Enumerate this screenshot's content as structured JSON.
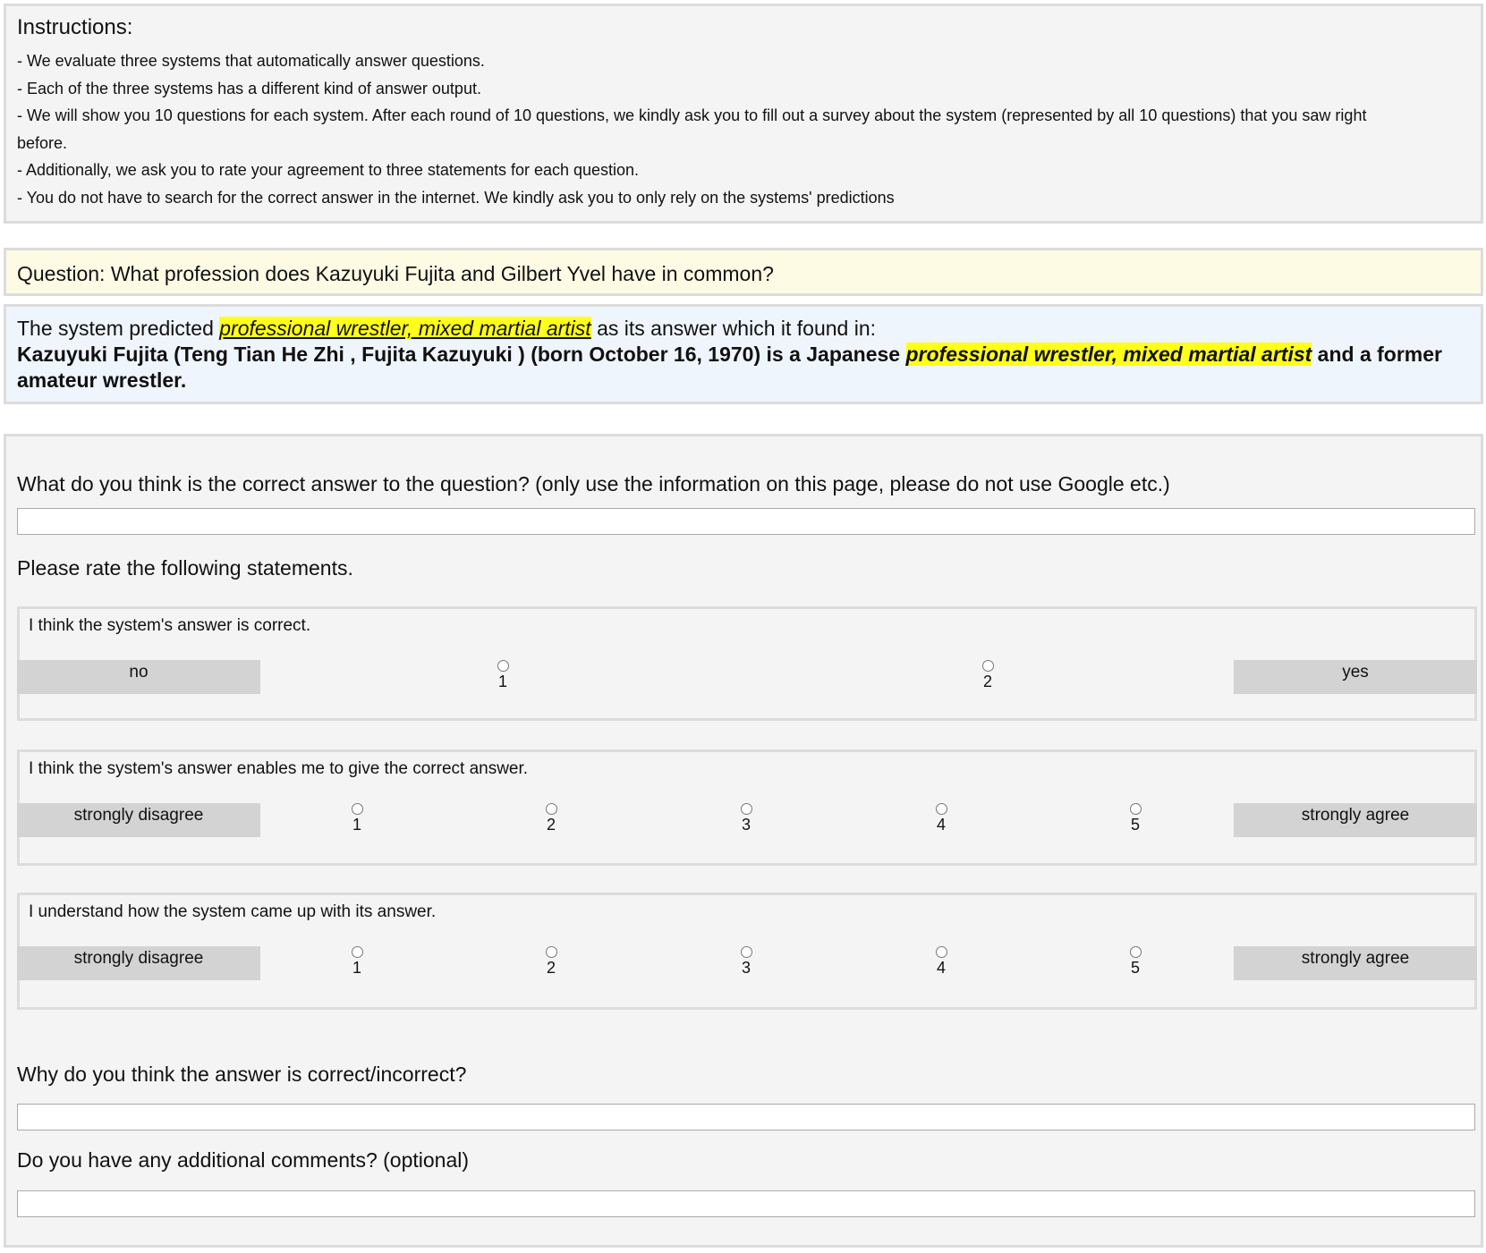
{
  "instructions": {
    "title": "Instructions:",
    "lines": [
      "- We evaluate three systems that automatically answer questions.",
      "- Each of the three systems has a different kind of answer output.",
      "- We will show you 10 questions for each system. After each round of 10 questions, we kindly ask you to fill out a survey about the system (represented by all 10 questions) that you saw right",
      "before.",
      "- Additionally, we ask you to rate your agreement to three statements for each question.",
      "- You do not have to search for the correct answer in the internet. We kindly ask you to only rely on the systems' predictions"
    ]
  },
  "question": {
    "text": "Question: What profession does Kazuyuki Fujita and Gilbert Yvel have in common?"
  },
  "answer": {
    "prefix": "The system predicted ",
    "predicted": "professional wrestler, mixed martial artist",
    "suffix": " as its answer which it found in:",
    "context_before": "Kazuyuki Fujita (Teng Tian He Zhi , Fujita Kazuyuki ) (born October 16, 1970) is a Japanese ",
    "context_highlight": "professional wrestler, mixed martial artist",
    "context_after": " and a former amateur wrestler."
  },
  "survey": {
    "q_correct_answer": "What do you think is the correct answer to the question? (only use the information on this page, please do not use Google etc.)",
    "correct_answer_value": "",
    "rate_heading": "Please rate the following statements.",
    "ratings": [
      {
        "statement": "I think the system's answer is correct.",
        "left": "no",
        "right": "yes",
        "options": [
          "1",
          "2"
        ]
      },
      {
        "statement": "I think the system's answer enables me to give the correct answer.",
        "left": "strongly disagree",
        "right": "strongly agree",
        "options": [
          "1",
          "2",
          "3",
          "4",
          "5"
        ]
      },
      {
        "statement": "I understand how the system came up with its answer.",
        "left": "strongly disagree",
        "right": "strongly agree",
        "options": [
          "1",
          "2",
          "3",
          "4",
          "5"
        ]
      }
    ],
    "q_why": "Why do you think the answer is correct/incorrect?",
    "why_value": "",
    "q_comments": "Do you have any additional comments? (optional)",
    "comments_value": ""
  }
}
